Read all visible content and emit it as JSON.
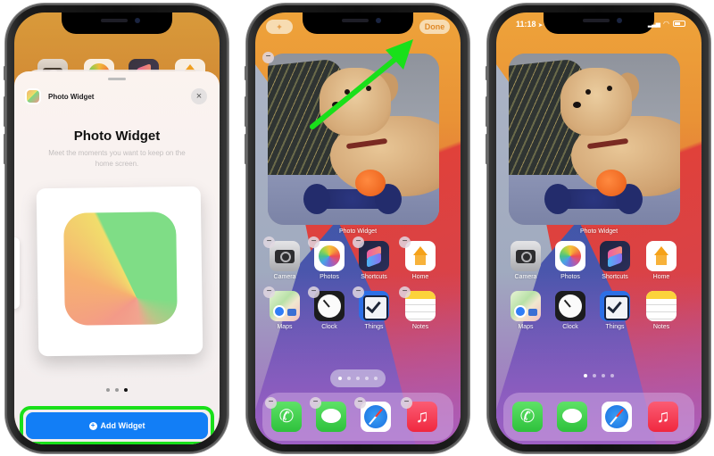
{
  "phone1": {
    "sheet": {
      "app_name": "Photo Widget",
      "title": "Photo Widget",
      "subtitle": "Meet the moments you want to keep on the home screen.",
      "close_icon": "×",
      "page_indicator": {
        "count": 3,
        "active_index": 2
      },
      "add_button_label": "Add Widget",
      "add_button_icon": "+"
    },
    "colors": {
      "button_blue": "#127ef6",
      "highlight_green": "#19e01a"
    }
  },
  "phone2": {
    "add_button_label": "+",
    "done_button_label": "Done",
    "widget_label": "Photo Widget",
    "remove_icon": "−",
    "apps": [
      {
        "label": "Camera",
        "icon": "camera-icon"
      },
      {
        "label": "Photos",
        "icon": "photos-icon"
      },
      {
        "label": "Shortcuts",
        "icon": "shortcuts-icon"
      },
      {
        "label": "Home",
        "icon": "home-icon"
      },
      {
        "label": "Maps",
        "icon": "maps-icon"
      },
      {
        "label": "Clock",
        "icon": "clock-icon"
      },
      {
        "label": "Things",
        "icon": "things-icon"
      },
      {
        "label": "Notes",
        "icon": "notes-icon"
      }
    ],
    "page_indicator": {
      "count": 5,
      "active_index": 0
    },
    "dock": [
      "phone-icon",
      "messages-icon",
      "safari-icon",
      "music-icon"
    ],
    "arrow_color": "#19e01a"
  },
  "phone3": {
    "status": {
      "time": "11:18",
      "location_icon": "➤",
      "wifi_icon": "wifi",
      "signal_icon": "signal"
    },
    "widget_label": "Photo Widget",
    "apps": [
      {
        "label": "Camera",
        "icon": "camera-icon"
      },
      {
        "label": "Photos",
        "icon": "photos-icon"
      },
      {
        "label": "Shortcuts",
        "icon": "shortcuts-icon"
      },
      {
        "label": "Home",
        "icon": "home-icon"
      },
      {
        "label": "Maps",
        "icon": "maps-icon"
      },
      {
        "label": "Clock",
        "icon": "clock-icon"
      },
      {
        "label": "Things",
        "icon": "things-icon"
      },
      {
        "label": "Notes",
        "icon": "notes-icon"
      }
    ],
    "page_indicator": {
      "count": 4,
      "active_index": 0
    },
    "dock": [
      "phone-icon",
      "messages-icon",
      "safari-icon",
      "music-icon"
    ]
  }
}
